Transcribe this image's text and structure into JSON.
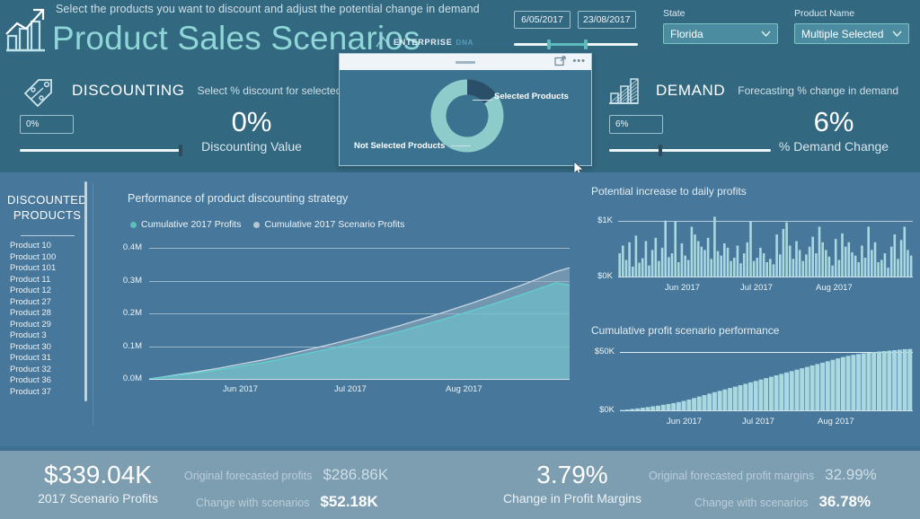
{
  "header": {
    "subtitle": "Select the products you want to discount and adjust the potential change in demand",
    "title": "Product Sales Scenarios",
    "logo_icon": "growth-chart-icon",
    "brand": {
      "mark_icon": "enterprise-dna-mark-icon",
      "text1": "ENTERPRISE",
      "text2": "DNA"
    }
  },
  "date_slicer": {
    "start": "6/05/2017",
    "end": "23/08/2017",
    "handle_icon": "range-handle-icon"
  },
  "state_slicer": {
    "label": "State",
    "value": "Florida",
    "chevron_icon": "chevron-down-icon"
  },
  "product_slicer": {
    "label": "Product Name",
    "value": "Multiple Selected",
    "chevron_icon": "chevron-down-icon"
  },
  "discounting": {
    "icon": "price-tag-percent-icon",
    "name": "DISCOUNTING",
    "description": "Select % discount for selected products",
    "input_value": "0%",
    "big_value": "0%",
    "big_label": "Discounting Value"
  },
  "demand": {
    "icon": "bar-trend-icon",
    "name": "DEMAND",
    "description": "Forecasting % change in demand",
    "input_value": "6%",
    "big_value": "6%",
    "big_label": "% Demand Change"
  },
  "popup": {
    "grip_icon": "drag-grip-icon",
    "focus_icon": "focus-mode-icon",
    "more_icon": "more-options-icon",
    "label_selected": "Selected Products",
    "label_not_selected": "Not Selected Products",
    "colors": {
      "selected": "#2a4f68",
      "not_selected": "#8ecccc"
    },
    "chart_data": {
      "type": "pie",
      "title": "",
      "categories": [
        "Selected Products",
        "Not Selected Products"
      ],
      "values": [
        15,
        85
      ],
      "legend": "annotated-labels"
    }
  },
  "cursor_icon": "mouse-pointer-icon",
  "product_panel": {
    "title_line1": "DISCOUNTED",
    "title_line2": "PRODUCTS",
    "items": [
      "Product 10",
      "Product 100",
      "Product 101",
      "Product 11",
      "Product 12",
      "Product 27",
      "Product 28",
      "Product 29",
      "Product 3",
      "Product 30",
      "Product 31",
      "Product 32",
      "Product 36",
      "Product 37"
    ],
    "scrollbar_icon": "vertical-scrollbar"
  },
  "main_chart": {
    "title": "Performance of product discounting strategy",
    "chart_data": {
      "type": "area",
      "title": "Performance of product discounting strategy",
      "xlabel": "",
      "ylabel": "",
      "ylim": [
        0,
        400000
      ],
      "yticks": [
        "0.0M",
        "0.1M",
        "0.2M",
        "0.3M",
        "0.4M"
      ],
      "xticks": [
        "Jun 2017",
        "Jul 2017",
        "Aug 2017"
      ],
      "grid": true,
      "legend": [
        "Cumulative 2017 Profits",
        "Cumulative 2017 Scenario Profits"
      ],
      "legend_position": "top-left",
      "colors": {
        "Cumulative 2017 Profits": "#5bbfbf",
        "Cumulative 2017 Scenario Profits": "#b5c7d4"
      },
      "series": [
        {
          "name": "Cumulative 2017 Scenario Profits",
          "values": [
            0,
            6000,
            13000,
            19000,
            26000,
            33000,
            41000,
            49000,
            57000,
            66000,
            76000,
            86000,
            96000,
            106000,
            117000,
            128000,
            140000,
            152000,
            164000,
            177000,
            190000,
            203000,
            217000,
            231000,
            246000,
            261000,
            277000,
            293000,
            310000,
            327000,
            339040
          ]
        },
        {
          "name": "Cumulative 2017 Profits",
          "values": [
            0,
            5000,
            11000,
            16000,
            22000,
            28000,
            35000,
            42000,
            49000,
            57000,
            66000,
            75000,
            84000,
            93000,
            103000,
            113000,
            124000,
            135000,
            146000,
            158000,
            170000,
            182000,
            195000,
            208000,
            221000,
            235000,
            249000,
            263000,
            278000,
            293000,
            286860
          ]
        }
      ]
    }
  },
  "right_chart_top": {
    "title": "Potential increase to daily profits",
    "chart_data": {
      "type": "bar",
      "title": "Potential increase to daily profits",
      "xlabel": "",
      "ylabel": "",
      "ylim": [
        0,
        1200
      ],
      "yticks": [
        "$0K",
        "$1K"
      ],
      "xticks": [
        "Jun 2017",
        "Jul 2017",
        "Aug 2017"
      ],
      "grid": true,
      "color": "#a9d8e0",
      "values": [
        420,
        560,
        300,
        620,
        180,
        740,
        250,
        330,
        640,
        200,
        480,
        700,
        280,
        520,
        1010,
        350,
        420,
        1000,
        260,
        600,
        380,
        300,
        900,
        760,
        640,
        540,
        480,
        700,
        320,
        1080,
        460,
        380,
        600,
        520,
        280,
        340,
        560,
        240,
        420,
        620,
        1000,
        280,
        340,
        520,
        420,
        260,
        320,
        220,
        760,
        400,
        860,
        980,
        560,
        320,
        640,
        480,
        280,
        400,
        540,
        720,
        420,
        900,
        620,
        480,
        360,
        200,
        680,
        300,
        780,
        540,
        620,
        440,
        380,
        260,
        560,
        340,
        900,
        480,
        620,
        260,
        300,
        420,
        160,
        540,
        760,
        320,
        660,
        900,
        480,
        380
      ]
    }
  },
  "right_chart_bottom": {
    "title": "Cumulative profit scenario performance",
    "chart_data": {
      "type": "area",
      "title": "Cumulative profit scenario performance",
      "xlabel": "",
      "ylabel": "",
      "ylim": [
        0,
        55000
      ],
      "yticks": [
        "$0K",
        "$50K"
      ],
      "xticks": [
        "Jun 2017",
        "Jul 2017",
        "Aug 2017"
      ],
      "grid": true,
      "color": "#a9d8e0",
      "values": [
        300,
        700,
        1200,
        1700,
        2200,
        2800,
        3400,
        4000,
        4700,
        5400,
        6200,
        7000,
        8000,
        9200,
        10500,
        11800,
        13000,
        14200,
        15400,
        16600,
        17800,
        19000,
        20200,
        21400,
        22600,
        23800,
        25000,
        26200,
        27400,
        28600,
        29800,
        31000,
        32200,
        33400,
        34600,
        35800,
        37000,
        38200,
        39400,
        40600,
        41800,
        43000,
        44200,
        45400,
        46400,
        47200,
        47900,
        48500,
        49000,
        49500,
        50000,
        50400,
        50800,
        51200,
        51600,
        52000,
        52180
      ]
    }
  },
  "footer": {
    "kpi1": {
      "value": "$339.04K",
      "label": "2017 Scenario Profits"
    },
    "kpi2": {
      "value": "3.79%",
      "label": "Change in Profit Margins"
    },
    "sub1": {
      "label": "Original forecasted profits",
      "value": "$286.86K"
    },
    "sub2": {
      "label": "Change with scenarios",
      "value": "$52.18K"
    },
    "sub3": {
      "label": "Original forecasted profit margins",
      "value": "32.99%"
    },
    "sub4": {
      "label": "Change with scenarios",
      "value": "36.78%"
    }
  },
  "colors": {
    "header_bg": "#336881",
    "body_bg": "#47779a",
    "footer_bg": "#7d9db1",
    "accent_teal": "#5bbfbf",
    "title_teal": "#8fd6d6"
  }
}
